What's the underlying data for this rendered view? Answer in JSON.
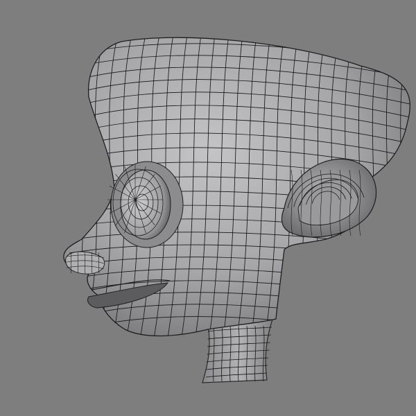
{
  "viewport": {
    "background_color": "#7e7e7e",
    "subject": "head-wireframe-mesh"
  },
  "model": {
    "surface_color": "#a9a9ab",
    "shadow_color": "#505052",
    "highlight_color": "#d6d6d8",
    "wire_color": "#161618",
    "shading": "smooth-with-wireframe-overlay"
  }
}
